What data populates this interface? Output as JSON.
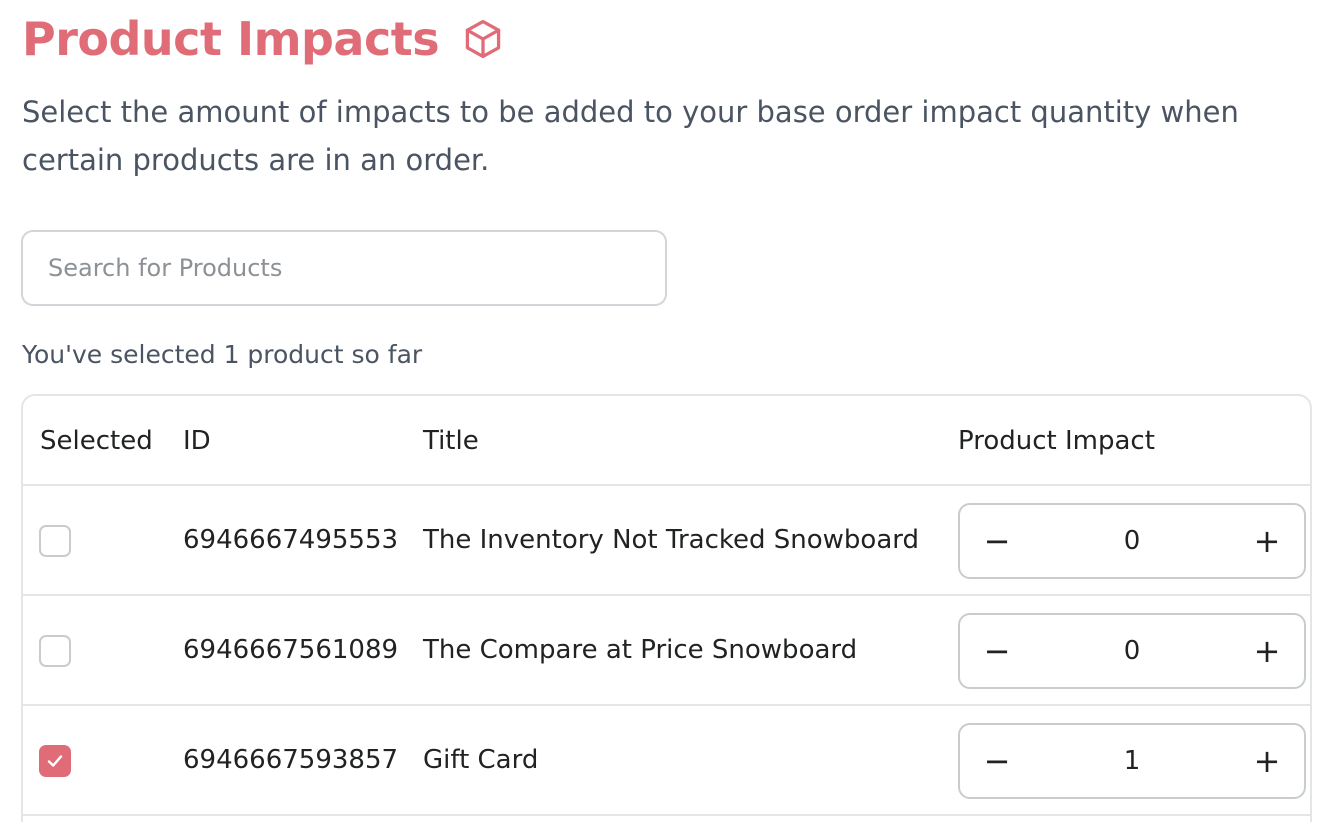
{
  "header": {
    "title": "Product Impacts",
    "title_icon": "cube-icon",
    "accent_color": "#e06c78"
  },
  "description": "Select the amount of impacts to be added to your base order impact quantity when certain products are in an order.",
  "search": {
    "placeholder": "Search for Products",
    "value": ""
  },
  "selection_summary": "You've selected 1 product so far",
  "table": {
    "columns": [
      "Selected",
      "ID",
      "Title",
      "Product Impact"
    ],
    "rows": [
      {
        "selected": false,
        "id": "6946667495553",
        "title": "The Inventory Not Tracked Snowboard",
        "impact": "0",
        "minus": "−",
        "plus": "+"
      },
      {
        "selected": false,
        "id": "6946667561089",
        "title": "The Compare at Price Snowboard",
        "impact": "0",
        "minus": "−",
        "plus": "+"
      },
      {
        "selected": true,
        "id": "6946667593857",
        "title": "Gift Card",
        "impact": "1",
        "minus": "−",
        "plus": "+"
      }
    ]
  }
}
